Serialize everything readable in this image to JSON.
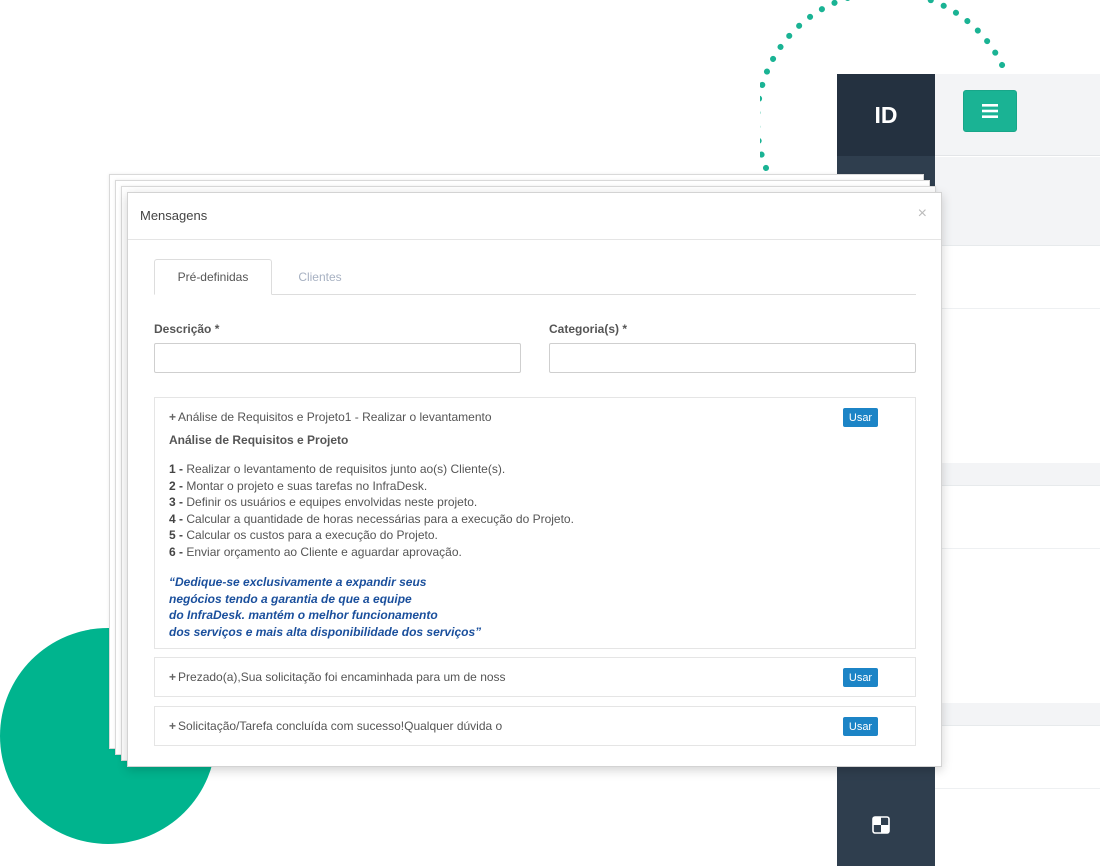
{
  "app": {
    "brand": "ID",
    "menu_icon": "hamburger-icon",
    "sidebar_icon": "dashboard-icon",
    "accent_color": "#1ab394"
  },
  "modal": {
    "title": "Mensagens",
    "close": "×",
    "tabs": [
      {
        "label": "Pré-definidas",
        "active": true
      },
      {
        "label": "Clientes",
        "active": false
      }
    ],
    "fields": {
      "descricao_label": "Descrição *",
      "descricao_value": "",
      "categoria_label": "Categoria(s) *",
      "categoria_value": ""
    },
    "messages": [
      {
        "prefix": "+",
        "title": "Análise de Requisitos e Projeto1 - Realizar o levantamento",
        "use_label": "Usar",
        "expanded": true,
        "body_title": "Análise de Requisitos e Projeto",
        "steps": [
          {
            "num": "1 -",
            "text": "Realizar o levantamento de requisitos junto ao(s) Cliente(s)."
          },
          {
            "num": "2 -",
            "text": "Montar o projeto e suas tarefas no InfraDesk."
          },
          {
            "num": "3 -",
            "text": "Definir os usuários e equipes envolvidas neste projeto."
          },
          {
            "num": "4 -",
            "text": "Calcular a quantidade de horas necessárias para a execução do Projeto."
          },
          {
            "num": "5 -",
            "text": "Calcular os custos para a execução do Projeto."
          },
          {
            "num": "6 -",
            "text": "Enviar orçamento ao Cliente e aguardar aprovação."
          }
        ],
        "quote_lines": [
          "“Dedique-se exclusivamente a expandir seus",
          "negócios tendo a garantia de que a equipe",
          "do InfraDesk. mantém o melhor funcionamento",
          "dos serviços e mais alta disponibilidade dos serviços”"
        ]
      },
      {
        "prefix": "+",
        "title": "Prezado(a),Sua solicitação foi encaminhada para um de noss",
        "use_label": "Usar",
        "expanded": false
      },
      {
        "prefix": "+",
        "title": "Solicitação/Tarefa concluída com sucesso!Qualquer dúvida o",
        "use_label": "Usar",
        "expanded": false
      }
    ]
  }
}
